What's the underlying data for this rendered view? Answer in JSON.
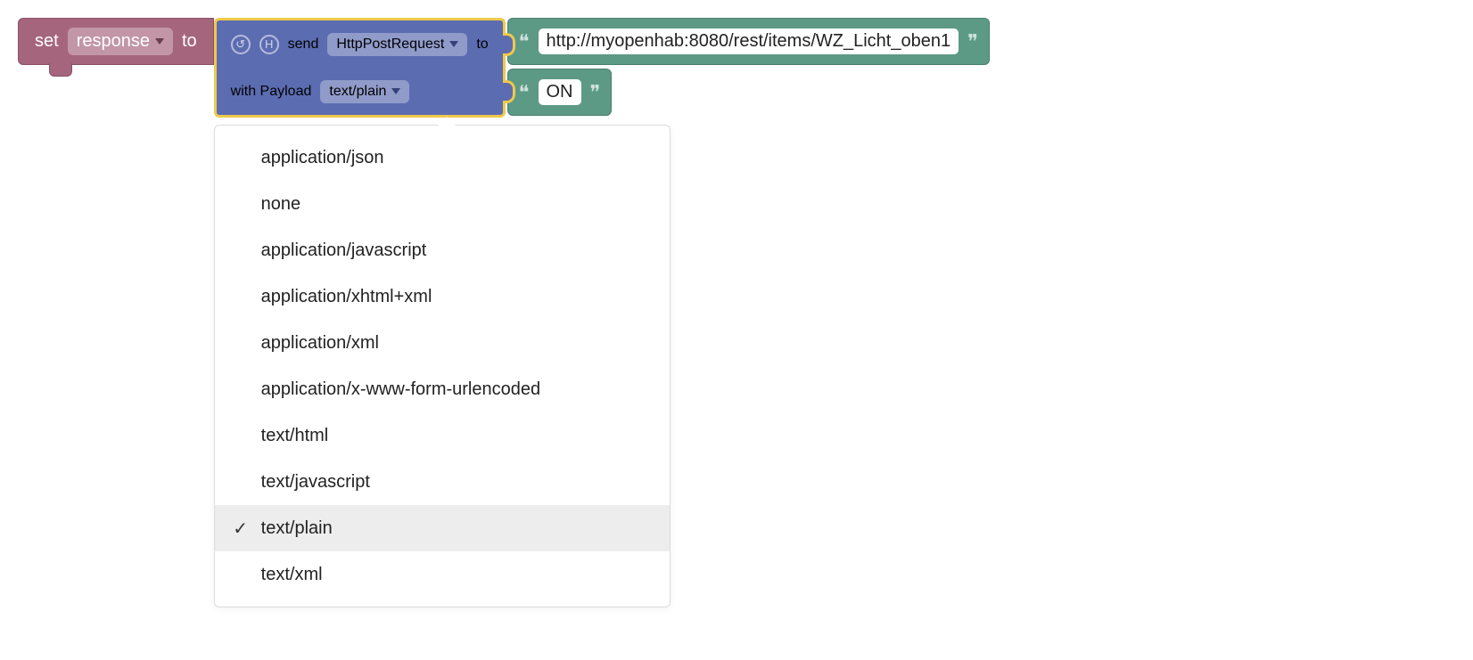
{
  "set_block": {
    "prefix": "set",
    "variable": "response",
    "suffix": "to"
  },
  "send_block": {
    "row1_prefix": "send",
    "request_type": "HttpPostRequest",
    "row1_suffix": "to",
    "row2_prefix": "with Payload",
    "content_type": "text/plain"
  },
  "url_block": {
    "value": "http://myopenhab:8080/rest/items/WZ_Licht_oben1"
  },
  "payload_block": {
    "value": "ON"
  },
  "dropdown_menu": {
    "selected": "text/plain",
    "options": [
      "application/json",
      "none",
      "application/javascript",
      "application/xhtml+xml",
      "application/xml",
      "application/x-www-form-urlencoded",
      "text/html",
      "text/javascript",
      "text/plain",
      "text/xml"
    ]
  }
}
